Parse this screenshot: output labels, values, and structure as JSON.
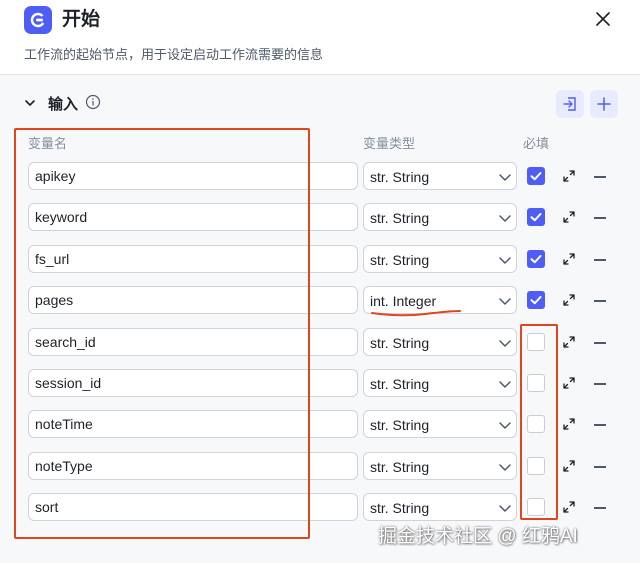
{
  "node": {
    "title": "开始",
    "description": "工作流的起始节点，用于设定启动工作流需要的信息"
  },
  "section": {
    "title": "输入"
  },
  "columns": {
    "name": "变量名",
    "type": "变量类型",
    "required": "必填"
  },
  "variables": [
    {
      "name": "apikey",
      "type": "str. String",
      "required": true
    },
    {
      "name": "keyword",
      "type": "str. String",
      "required": true
    },
    {
      "name": "fs_url",
      "type": "str. String",
      "required": true
    },
    {
      "name": "pages",
      "type": "int. Integer",
      "required": true
    },
    {
      "name": "search_id",
      "type": "str. String",
      "required": false
    },
    {
      "name": "session_id",
      "type": "str. String",
      "required": false
    },
    {
      "name": "noteTime",
      "type": "str. String",
      "required": false
    },
    {
      "name": "noteType",
      "type": "str. String",
      "required": false
    },
    {
      "name": "sort",
      "type": "str. String",
      "required": false
    }
  ],
  "watermark": "掘金技术社区 @ 红鸦AI",
  "colors": {
    "accent": "#4e5ef5",
    "annotation": "#e0461c"
  }
}
